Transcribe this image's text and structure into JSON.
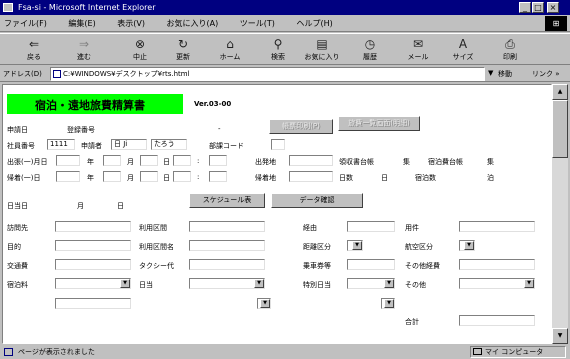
{
  "window": {
    "title": "Fsa-si - Microsoft Internet Explorer",
    "min": "_",
    "max": "□",
    "close": "×"
  },
  "menu": [
    "ファイル(F)",
    "編集(E)",
    "表示(V)",
    "お気に入り(A)",
    "ツール(T)",
    "ヘルプ(H)"
  ],
  "toolbar": [
    {
      "label": "戻る",
      "icon": "back-arrow-icon",
      "glyph": "⇐"
    },
    {
      "label": "進む",
      "icon": "forward-arrow-icon",
      "glyph": "⇒"
    },
    {
      "label": "中止",
      "icon": "stop-icon",
      "glyph": "⊗"
    },
    {
      "label": "更新",
      "icon": "refresh-icon",
      "glyph": "↻"
    },
    {
      "label": "ホーム",
      "icon": "home-icon",
      "glyph": "⌂"
    },
    {
      "label": "検索",
      "icon": "search-icon",
      "glyph": "⚲"
    },
    {
      "label": "お気に入り",
      "icon": "favorites-icon",
      "glyph": "▤"
    },
    {
      "label": "履歴",
      "icon": "history-icon",
      "glyph": "◷"
    },
    {
      "label": "メール",
      "icon": "mail-icon",
      "glyph": "✉"
    },
    {
      "label": "サイズ",
      "icon": "font-size-icon",
      "glyph": "A"
    },
    {
      "label": "印刷",
      "icon": "print-icon",
      "glyph": "⎙"
    }
  ],
  "address": {
    "label": "アドレス(D)",
    "value": "C:¥WINDOWS¥デスクトップ¥rts.html",
    "go": "移動",
    "links": "リンク »"
  },
  "form": {
    "heading": "宿泊・遠地旅費精算書",
    "version": "Ver.03-00",
    "btn_print": "帳票印刷(P)",
    "btn_hidden": "旅費一覧画面(明細)",
    "apply_date": "申請日",
    "reg_no": "登録番号",
    "dash": "-",
    "staff_no": "社員番号",
    "staff_no_val": "1111",
    "applicant": "申請者",
    "applicant_val": "日 Ji",
    "applicant_val2": "たろう",
    "dept_code": "部課コード",
    "depart_date": "出張(一)月日",
    "return_date": "帰着(一)日",
    "year": "年",
    "month": "月",
    "day": "日",
    "colon": ":",
    "depart_place": "出発地",
    "dest_place": "帰着地",
    "cost_count": "領収書台帳",
    "count_unit": "集",
    "stay_count": "宿泊費台帳",
    "days": "日数",
    "nights": "宿泊数",
    "nights_unit": "泊",
    "month_label": "日数",
    "pay_date": "日当日",
    "btn_schedule": "スケジュール表",
    "btn_data": "データ確認",
    "visit": "訪問先",
    "use_section": "利用区間",
    "route": "経由",
    "matter": "用件",
    "purpose": "目的",
    "use_section2": "利用区間名",
    "distance": "距離区分",
    "class_type": "航空区分",
    "trans": "交通費",
    "taxi": "タクシー代",
    "transfer": "乗車券等",
    "etc": "その他経費",
    "lodging": "宿泊料",
    "daily": "日当",
    "special": "特別日当",
    "other": "その他",
    "total": "合計"
  },
  "status": {
    "text": "ページが表示されました",
    "zone": "マイ コンピュータ"
  }
}
